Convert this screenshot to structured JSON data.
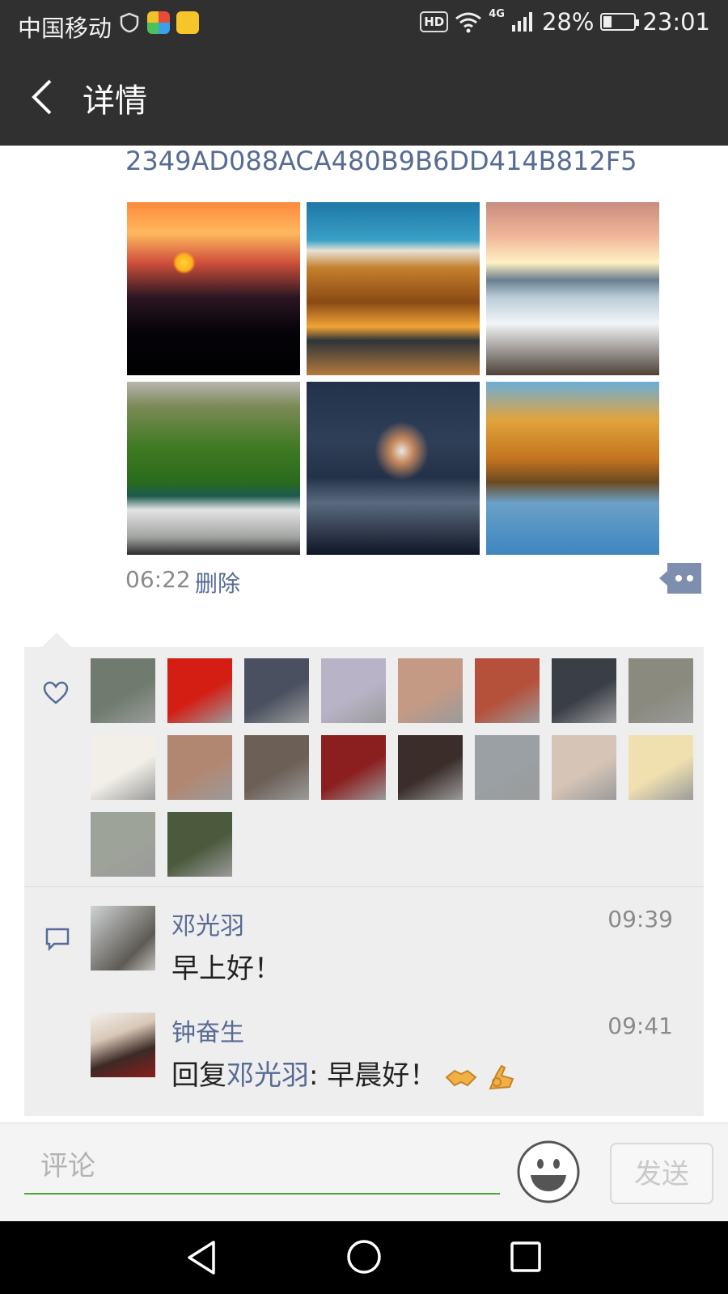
{
  "status_bar": {
    "carrier": "中国移动",
    "hd_badge": "HD",
    "network": "4G",
    "battery": "28%",
    "time": "23:01",
    "icons": [
      "shield-icon",
      "app-icon",
      "mail-app-icon",
      "wifi-icon",
      "signal-icon",
      "battery-icon"
    ]
  },
  "header": {
    "back_icon": "chevron-left-icon",
    "title": "详情"
  },
  "post": {
    "text": "2349AD088ACA480B9B6DD414B812F5",
    "photos": [
      "crane-sunset",
      "mountain-peak",
      "waterfall-sunset",
      "green-waterfall",
      "palace-night",
      "autumn-trees-lake"
    ],
    "time": "06:22",
    "delete_label": "删除",
    "more_icon": "more-dots-icon"
  },
  "likes": {
    "icon": "heart-icon",
    "avatars": [
      "#6e7b6e",
      "#d41e14",
      "#4a5060",
      "#b9b3c8",
      "#c59a84",
      "#b5503a",
      "#3a3f46",
      "#8a8a7e",
      "#f1efe8",
      "#b28772",
      "#6c5f55",
      "#8b1e1e",
      "#3a2d2a",
      "#9aa0a4",
      "#d6c5b6",
      "#f0e0b0",
      "#9ea39a",
      "#4b5a3c"
    ]
  },
  "comments": {
    "icon": "comment-icon",
    "items": [
      {
        "name": "邓光羽",
        "time": "09:39",
        "text": "早上好！"
      },
      {
        "name": "钟奋生",
        "time": "09:41",
        "reply_prefix": "回复",
        "reply_to": "邓光羽",
        "text": ": 早晨好！"
      }
    ]
  },
  "comment_bar": {
    "placeholder": "评论",
    "send_label": "发送"
  },
  "colors": {
    "accent_link": "#576b95",
    "topbar": "#303030",
    "input_underline": "#4aaa35"
  }
}
